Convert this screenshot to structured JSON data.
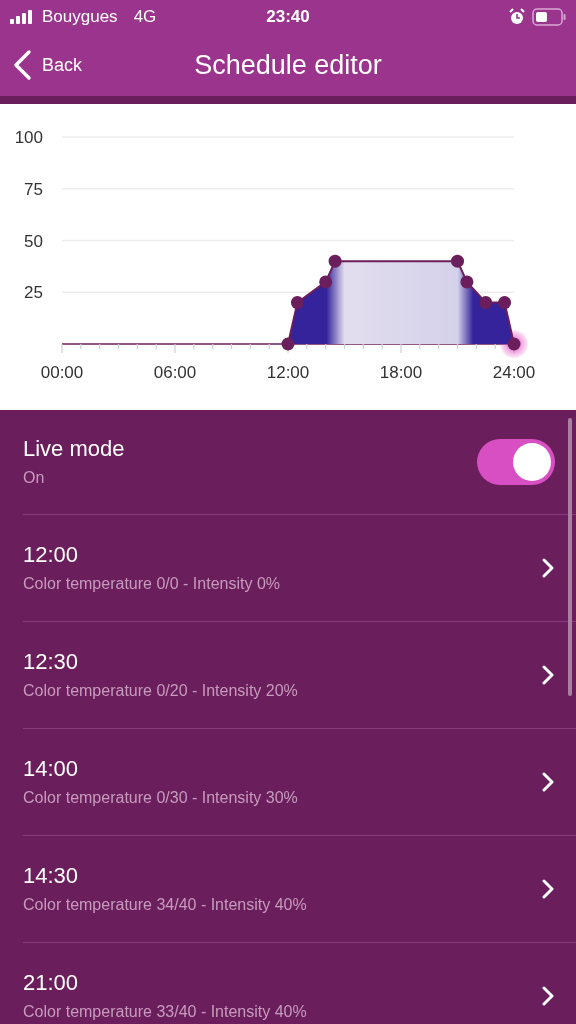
{
  "status_bar": {
    "carrier": "Bouygues",
    "network": "4G",
    "time": "23:40"
  },
  "nav": {
    "back": "Back",
    "title": "Schedule editor"
  },
  "chart": {
    "chart_data": {
      "type": "area",
      "x": [
        12,
        12.5,
        14,
        14.5,
        21,
        21.5,
        22.5,
        23.5,
        24
      ],
      "grid": true,
      "series": [
        {
          "color": "#6b1e5c",
          "values": [
            0,
            20,
            30,
            40,
            40,
            30,
            20,
            20,
            0
          ]
        }
      ],
      "xlim": [
        0,
        24
      ],
      "ylim": [
        0,
        100
      ],
      "xticks": [
        {
          "value": 0,
          "label": "00:00"
        },
        {
          "value": 6,
          "label": "06:00"
        },
        {
          "value": 12,
          "label": "12:00"
        },
        {
          "value": 18,
          "label": "18:00"
        },
        {
          "value": 24,
          "label": "24:00"
        }
      ],
      "yticks": [
        25,
        50,
        75,
        100
      ]
    }
  },
  "live_mode": {
    "label": "Live mode",
    "status": "On",
    "on": true
  },
  "entries": [
    {
      "time": "12:00",
      "detail": "Color temperature 0/0 - Intensity 0%"
    },
    {
      "time": "12:30",
      "detail": "Color temperature 0/20 - Intensity 20%"
    },
    {
      "time": "14:00",
      "detail": "Color temperature 0/30 - Intensity 30%"
    },
    {
      "time": "14:30",
      "detail": "Color temperature 34/40 - Intensity 40%"
    },
    {
      "time": "21:00",
      "detail": "Color temperature 33/40 - Intensity 40%"
    }
  ]
}
